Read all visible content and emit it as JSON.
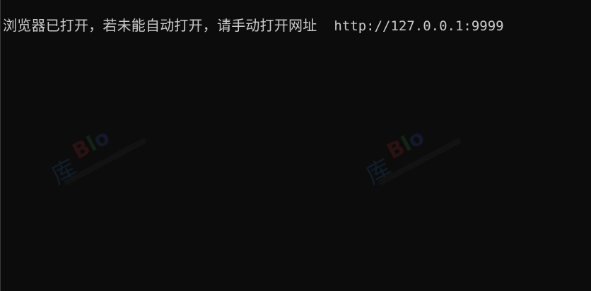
{
  "console": {
    "message": "浏览器已打开，若未能自动打开，请手动打开网址",
    "url": "http://127.0.0.1:9999"
  },
  "watermarks": [
    {
      "glyph": "库",
      "text_b": "B",
      "text_l": "l",
      "text_o": "o"
    },
    {
      "glyph": "库",
      "text_b": "B",
      "text_l": "l",
      "text_o": "o"
    }
  ],
  "colors": {
    "background": "#0c0c0c",
    "text": "#cccccc"
  }
}
